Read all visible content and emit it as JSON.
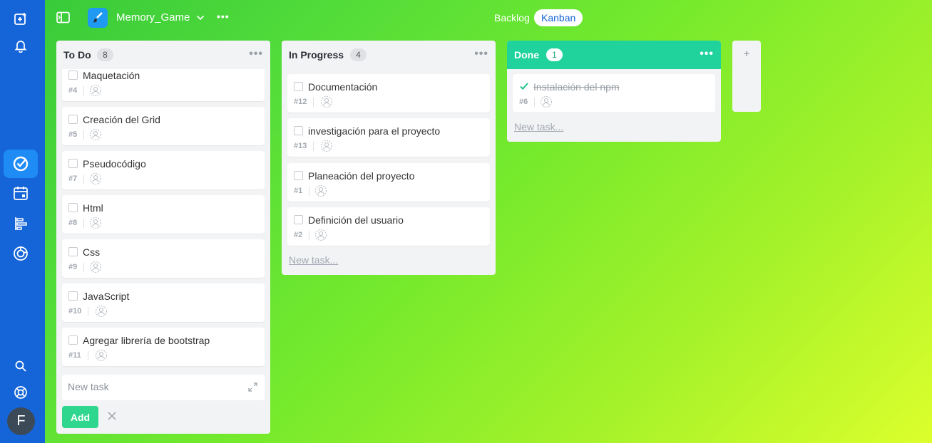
{
  "rail": {
    "icons": [
      "new-task-icon",
      "bell-icon",
      "tasks-icon",
      "calendar-icon",
      "timeline-icon",
      "dashboard-icon",
      "search-icon",
      "help-icon"
    ],
    "avatar_initial": "F"
  },
  "header": {
    "project_title": "Memory_Game",
    "views": [
      "Backlog",
      "Kanban"
    ],
    "active_view": "Kanban"
  },
  "columns": [
    {
      "name": "To Do",
      "count": "8",
      "cards": [
        {
          "title": "Maquetación",
          "id": "#4"
        },
        {
          "title": "Creación del Grid",
          "id": "#5"
        },
        {
          "title": "Pseudocódigo",
          "id": "#7"
        },
        {
          "title": "Html",
          "id": "#8"
        },
        {
          "title": "Css",
          "id": "#9"
        },
        {
          "title": "JavaScript",
          "id": "#10"
        },
        {
          "title": "Agregar librería de bootstrap",
          "id": "#11"
        }
      ],
      "new_task_placeholder": "New task",
      "add_label": "Add"
    },
    {
      "name": "In Progress",
      "count": "4",
      "cards": [
        {
          "title": "Documentación",
          "id": "#12"
        },
        {
          "title": "investigación para el proyecto",
          "id": "#13"
        },
        {
          "title": "Planeación del proyecto",
          "id": "#1"
        },
        {
          "title": "Definición del usuario",
          "id": "#2"
        }
      ],
      "new_task_link": "New task..."
    },
    {
      "name": "Done",
      "count": "1",
      "cards": [
        {
          "title": "Instalación del npm",
          "id": "#6",
          "done": true
        }
      ],
      "new_task_link": "New task..."
    }
  ],
  "add_column_label": "+",
  "colors": {
    "rail": "#1565d8",
    "done_header": "#20d39c",
    "add_button": "#2ed68e",
    "check": "#20c48a"
  }
}
